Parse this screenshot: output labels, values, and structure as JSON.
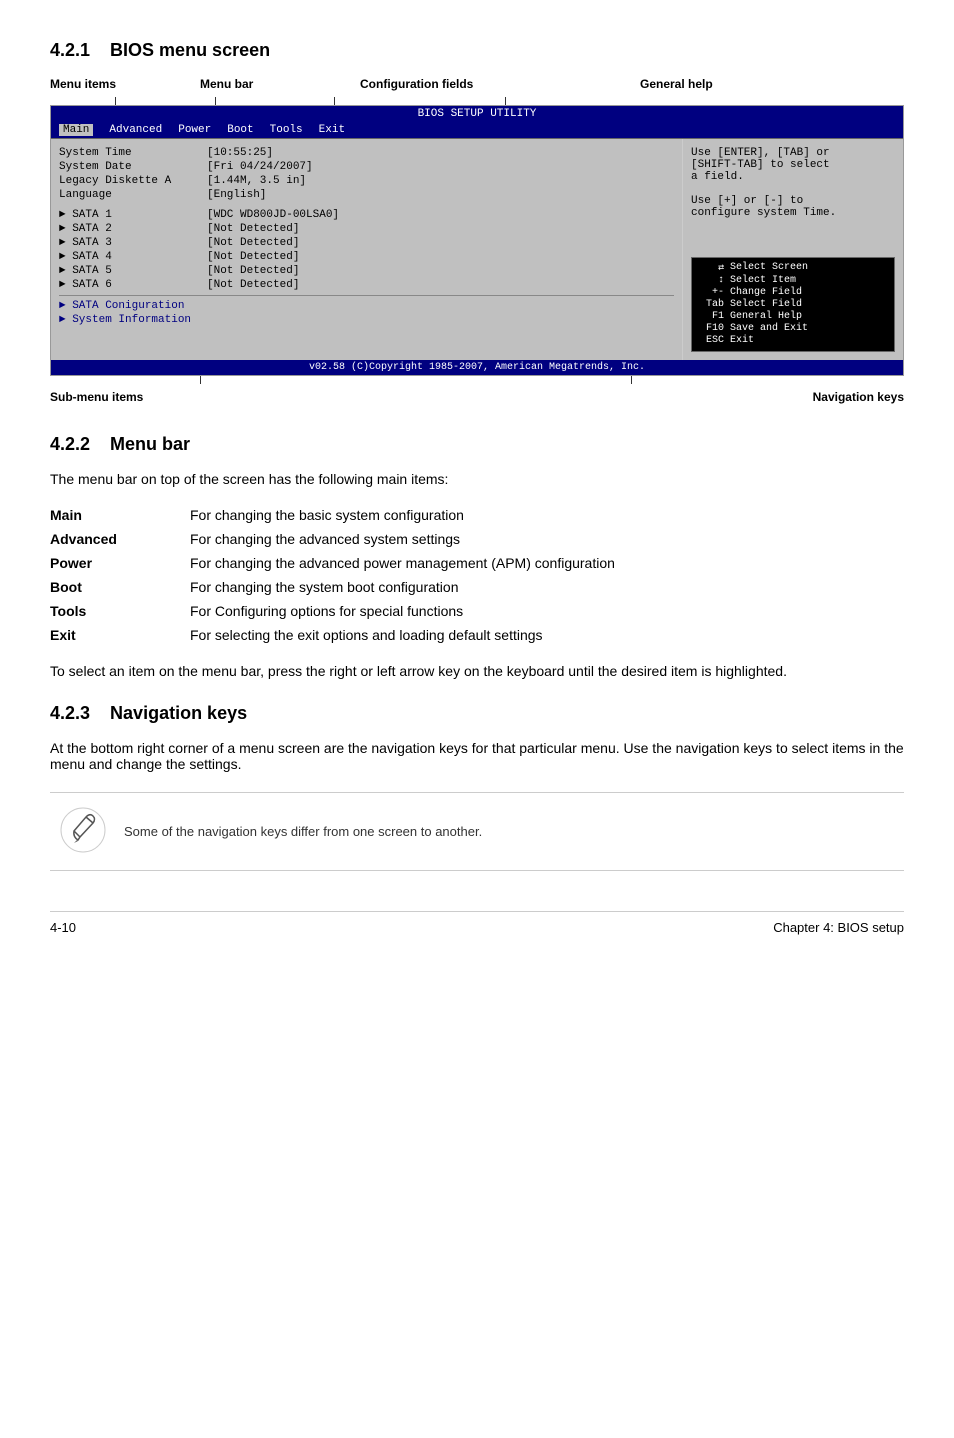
{
  "section421": {
    "number": "4.2.1",
    "title": "BIOS menu screen"
  },
  "diagram": {
    "labels_top": {
      "menu_items": "Menu items",
      "menu_bar": "Menu bar",
      "config_fields": "Configuration fields",
      "general_help": "General help"
    },
    "labels_bottom": {
      "sub_menu": "Sub-menu items",
      "nav_keys": "Navigation keys"
    },
    "bios": {
      "title": "BIOS SETUP UTILITY",
      "menu_items": [
        "Main",
        "Advanced",
        "Power",
        "Boot",
        "Tools",
        "Exit"
      ],
      "active_item": "Main",
      "fields": [
        {
          "label": "System Time",
          "value": "[10:55:25]"
        },
        {
          "label": "System Date",
          "value": "[Fri 04/24/2007]"
        },
        {
          "label": "Legacy Diskette A",
          "value": "[1.44M, 3.5 in]"
        },
        {
          "label": "Language",
          "value": "[English]"
        }
      ],
      "sata_items": [
        {
          "label": "SATA 1",
          "value": "[WDC WD800JD-00LSA0]"
        },
        {
          "label": "SATA 2",
          "value": "[Not Detected]"
        },
        {
          "label": "SATA 3",
          "value": "[Not Detected]"
        },
        {
          "label": "SATA 4",
          "value": "[Not Detected]"
        },
        {
          "label": "SATA 5",
          "value": "[Not Detected]"
        },
        {
          "label": "SATA 6",
          "value": "[Not Detected]"
        }
      ],
      "sub_menu_items": [
        "SATA Coniguration",
        "System Information"
      ],
      "help_text": [
        "Use [ENTER], [TAB] or",
        "[SHIFT-TAB] to select",
        "a field.",
        "",
        "Use [+] or [-] to",
        "configure system Time."
      ],
      "nav_keys": [
        {
          "key": "↔←",
          "desc": "Select Screen"
        },
        {
          "key": "↕",
          "desc": "Select Item"
        },
        {
          "key": "+-",
          "desc": "Change Field"
        },
        {
          "key": "Tab",
          "desc": "Select Field"
        },
        {
          "key": "F1",
          "desc": "General Help"
        },
        {
          "key": "F10",
          "desc": "Save and Exit"
        },
        {
          "key": "ESC",
          "desc": "Exit"
        }
      ],
      "footer": "v02.58 (C)Copyright 1985-2007, American Megatrends, Inc."
    }
  },
  "section422": {
    "number": "4.2.2",
    "title": "Menu bar",
    "intro": "The menu bar on top of the screen has the following main items:",
    "items": [
      {
        "name": "Main",
        "desc": "For changing the basic system configuration"
      },
      {
        "name": "Advanced",
        "desc": "For changing the advanced system settings"
      },
      {
        "name": "Power",
        "desc": "For changing the advanced power management (APM) configuration"
      },
      {
        "name": "Boot",
        "desc": "For changing the system boot configuration"
      },
      {
        "name": "Tools",
        "desc": "For Configuring options for special functions"
      },
      {
        "name": "Exit",
        "desc": "For selecting the exit options and loading default settings"
      }
    ],
    "nav_text": "To select an item on the menu bar, press the right or left arrow key on the keyboard until the desired item is highlighted."
  },
  "section423": {
    "number": "4.2.3",
    "title": "Navigation keys",
    "text": "At the bottom right corner of a menu screen are the navigation keys for that particular menu. Use the navigation keys to select items in the menu and change the settings."
  },
  "note": {
    "text": "Some of the navigation keys differ from one screen to another."
  },
  "footer": {
    "page": "4-10",
    "chapter": "Chapter 4: BIOS setup"
  }
}
